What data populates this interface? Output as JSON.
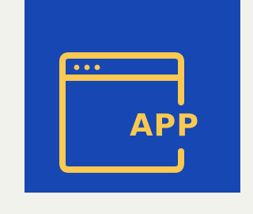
{
  "icon": {
    "name": "app-window-icon",
    "label": "APP",
    "colors": {
      "page_background": "#f2f2ec",
      "tile_background": "#1747b3",
      "accent": "#fcc950"
    }
  }
}
